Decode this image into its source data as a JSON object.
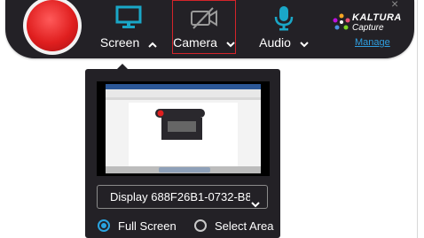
{
  "toolbar": {
    "screen_label": "Screen",
    "camera_label": "Camera",
    "audio_label": "Audio",
    "brand_name": "KALTURA",
    "brand_sub": "Capture",
    "manage_label": "Manage",
    "close_glyph": "×"
  },
  "icons": {
    "record": "record-button",
    "screen": "monitor-icon",
    "camera": "camera-off-icon",
    "audio": "microphone-icon",
    "expand_screen": "chevron-up-icon",
    "expand_camera": "chevron-down-icon",
    "expand_audio": "chevron-down-icon",
    "logo": "kaltura-logo"
  },
  "colors": {
    "toolbar_bg": "#232126",
    "record_red": "#e01f1f",
    "accent_teal": "#1aa7c7",
    "radio_selected": "#2aa4e0",
    "camera_highlight_border": "#d4242a",
    "manage_link": "#2f9fe0"
  },
  "screen_panel": {
    "display_select_value": "Display 688F26B1-0732-B8...",
    "options": [
      {
        "label": "Full Screen",
        "selected": true
      },
      {
        "label": "Select Area",
        "selected": false
      }
    ]
  }
}
